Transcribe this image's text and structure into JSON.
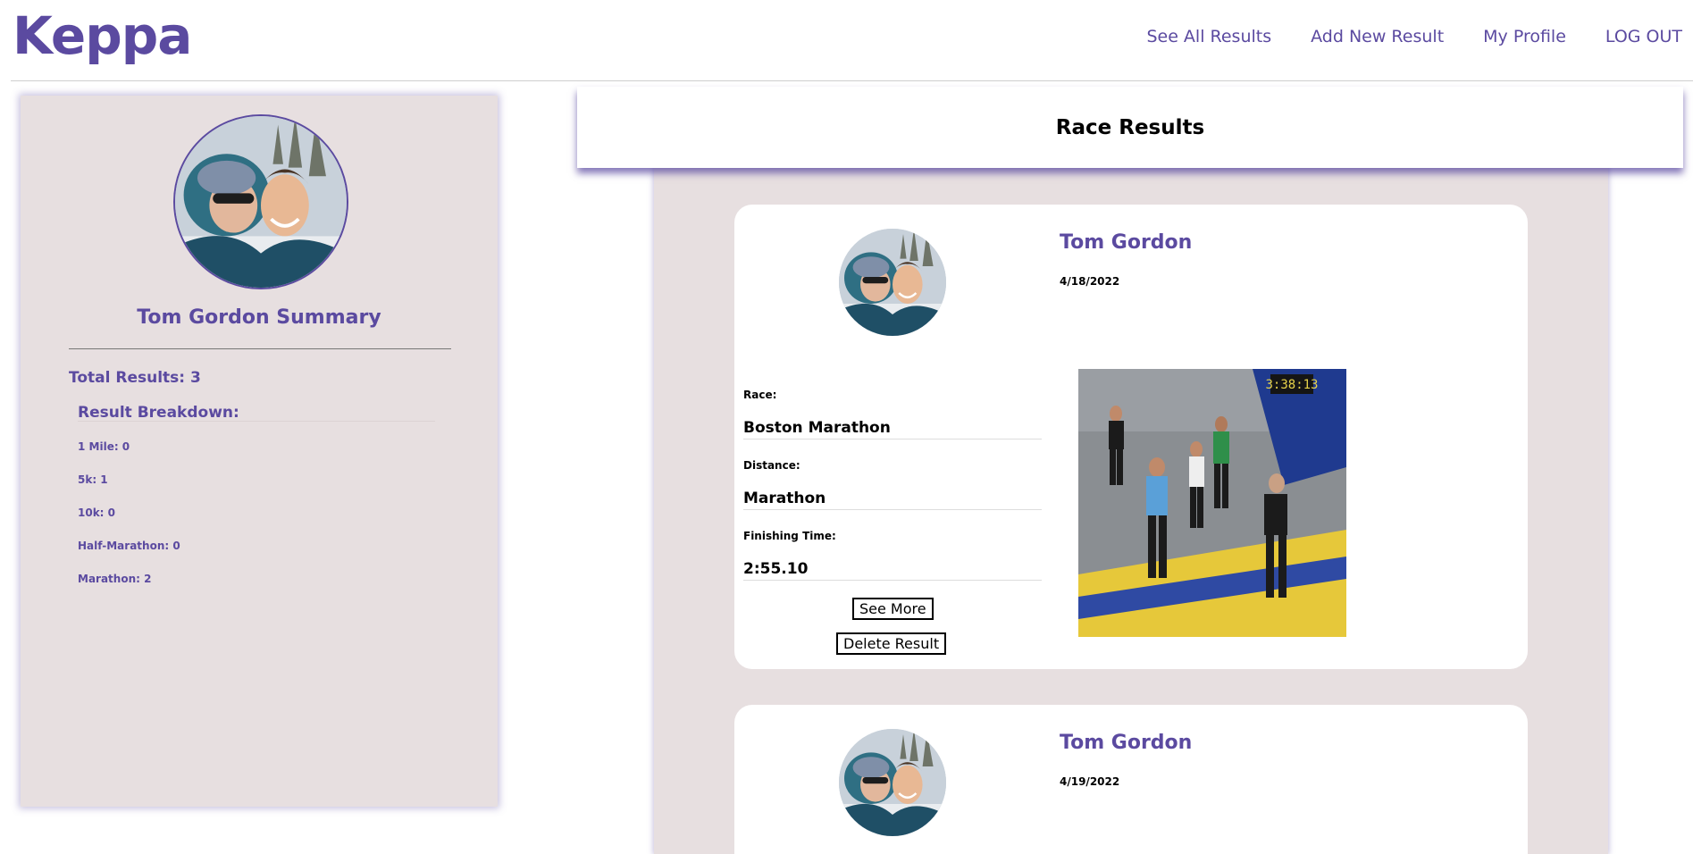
{
  "app": {
    "brand": "Keppa"
  },
  "nav": {
    "see_all": "See All Results",
    "add_new": "Add New Result",
    "profile": "My Profile",
    "logout": "LOG OUT"
  },
  "summary": {
    "title": "Tom Gordon Summary",
    "total": "Total Results: 3",
    "breakdown_title": "Result Breakdown:",
    "breakdown": [
      "1 Mile: 0",
      "5k: 1",
      "10k: 0",
      "Half-Marathon: 0",
      "Marathon: 2"
    ]
  },
  "results": {
    "title": "Race Results",
    "cards": [
      {
        "name": "Tom Gordon",
        "date": "4/18/2022",
        "race_label": "Race:",
        "race": "Boston Marathon",
        "distance_label": "Distance:",
        "distance": "Marathon",
        "time_label": "Finishing Time:",
        "time": "2:55.10",
        "see_more": "See More",
        "delete": "Delete Result",
        "photo_clock": "3:38:13"
      },
      {
        "name": "Tom Gordon",
        "date": "4/19/2022"
      }
    ]
  },
  "colors": {
    "accent": "#5b4aa0",
    "panel": "#e7dfe0"
  }
}
